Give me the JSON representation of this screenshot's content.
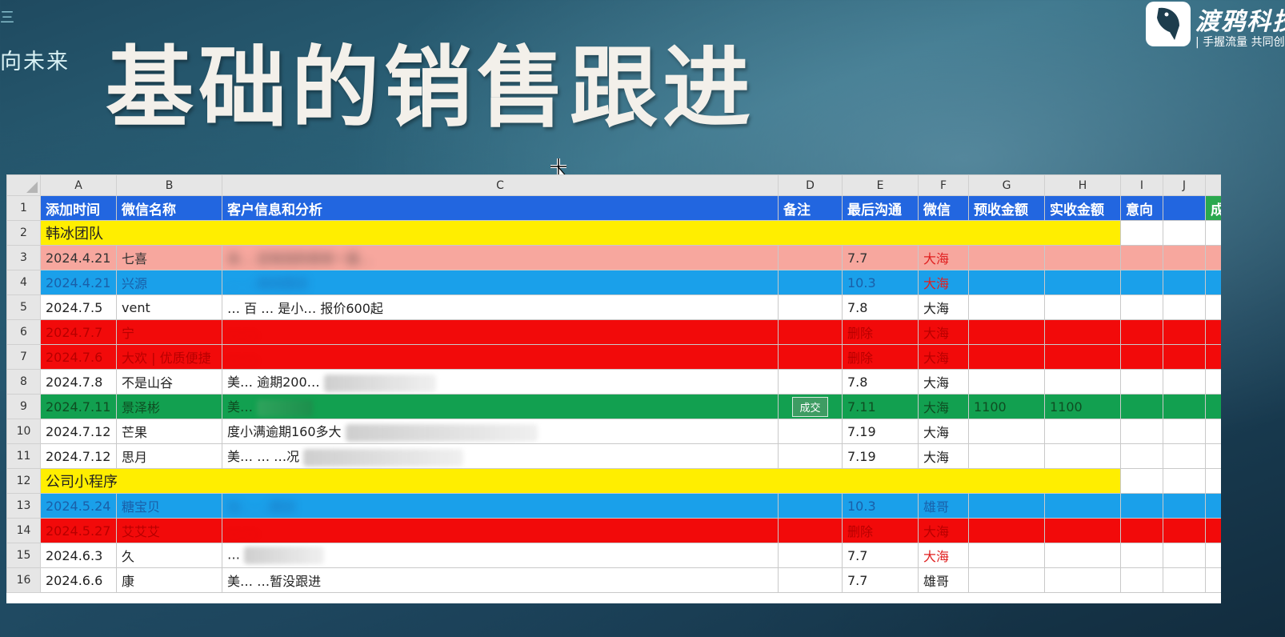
{
  "slide": {
    "left_slogan": "向未来",
    "title": "基础的销售跟进",
    "logo": {
      "name": "渡鸦科技",
      "tagline": "| 手握流量  共同创"
    }
  },
  "sheet": {
    "column_letters": [
      "A",
      "B",
      "C",
      "D",
      "E",
      "F",
      "G",
      "H",
      "I",
      "J"
    ],
    "header": {
      "cols": [
        "添加时间",
        "微信名称",
        "客户信息和分析",
        "备注",
        "最后沟通",
        "微信",
        "预收金额",
        "实收金额",
        "意向",
        ""
      ],
      "extra_tab": "成"
    },
    "groups": {
      "g1": "韩冰团队",
      "g2": "公司小程序"
    },
    "rows": [
      {
        "num": "3",
        "date": "2024.4.21",
        "name": "七喜",
        "info": "未…   还有别的债务一直…",
        "note": "",
        "last": "7.7",
        "wx": "大海",
        "pre": "",
        "act": ""
      },
      {
        "num": "4",
        "date": "2024.4.21",
        "name": "兴源",
        "info": "…    …继续跟进",
        "note": "",
        "last": "10.3",
        "wx": "大海",
        "pre": "",
        "act": ""
      },
      {
        "num": "5",
        "date": "2024.7.5",
        "name": "vent",
        "info": "…  百  …   是小…   报价600起",
        "note": "",
        "last": "7.8",
        "wx": "大海",
        "pre": "",
        "act": ""
      },
      {
        "num": "6",
        "date": "2024.7.7",
        "name": "宁",
        "info": "…  …",
        "note": "",
        "last": "删除",
        "wx": "大海",
        "pre": "",
        "act": ""
      },
      {
        "num": "7",
        "date": "2024.7.6",
        "name": "大欢 | 优质便捷",
        "info": "…  …",
        "note": "",
        "last": "删除",
        "wx": "大海",
        "pre": "",
        "act": ""
      },
      {
        "num": "8",
        "date": "2024.7.8",
        "name": "不是山谷",
        "info": "美…   逾期200…",
        "note": "",
        "last": "7.8",
        "wx": "大海",
        "pre": "",
        "act": ""
      },
      {
        "num": "9",
        "date": "2024.7.11",
        "name": "景泽彬",
        "info": "美…",
        "note": "成交",
        "last": "7.11",
        "wx": "大海",
        "pre": "1100",
        "act": "1100"
      },
      {
        "num": "10",
        "date": "2024.7.12",
        "name": "芒果",
        "info": "度小满逾期160多大",
        "note": "",
        "last": "7.19",
        "wx": "大海",
        "pre": "",
        "act": ""
      },
      {
        "num": "11",
        "date": "2024.7.12",
        "name": "思月",
        "info": "美…   …   …况",
        "note": "",
        "last": "7.19",
        "wx": "大海",
        "pre": "",
        "act": ""
      },
      {
        "num": "13",
        "date": "2024.5.24",
        "name": "糖宝贝",
        "info": "加…   …跟进",
        "note": "",
        "last": "10.3",
        "wx": "雄哥",
        "pre": "",
        "act": ""
      },
      {
        "num": "14",
        "date": "2024.5.27",
        "name": "艾艾艾",
        "info": "…  …",
        "note": "",
        "last": "删除",
        "wx": "大海",
        "pre": "",
        "act": ""
      },
      {
        "num": "15",
        "date": "2024.6.3",
        "name": "久",
        "info": "…",
        "note": "",
        "last": "7.7",
        "wx": "大海",
        "pre": "",
        "act": ""
      },
      {
        "num": "16",
        "date": "2024.6.6",
        "name": "康",
        "info": "美…   …暂没跟进",
        "note": "",
        "last": "7.7",
        "wx": "雄哥",
        "pre": "",
        "act": ""
      }
    ],
    "row_colors": {
      "pink": "#f7a79e",
      "blue": "#1aa0ea",
      "red": "#f20a0a",
      "green": "#12a050",
      "yellow": "#ffee00",
      "header": "#2266e0"
    }
  }
}
